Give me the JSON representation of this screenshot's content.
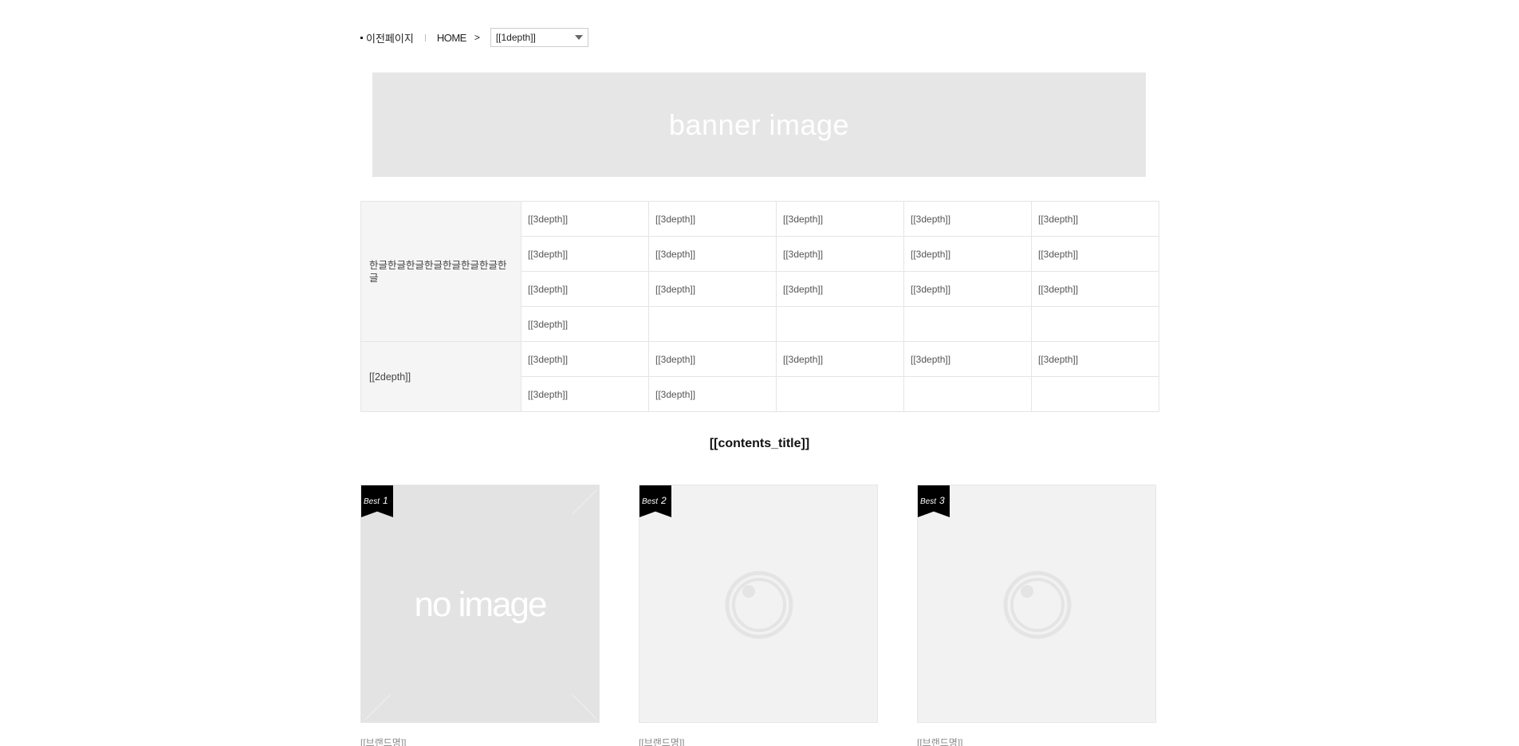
{
  "breadcrumb": {
    "prev_label": "이전페이지",
    "home_label": "HOME",
    "arrow": ">",
    "select_value": "[[1depth]]"
  },
  "banner": {
    "text": "banner image"
  },
  "category_table": {
    "groups": [
      {
        "title": "한글한글한글한글한글한글한글한글",
        "rows": [
          [
            "[[3depth]]",
            "[[3depth]]",
            "[[3depth]]",
            "[[3depth]]",
            "[[3depth]]"
          ],
          [
            "[[3depth]]",
            "[[3depth]]",
            "[[3depth]]",
            "[[3depth]]",
            "[[3depth]]"
          ],
          [
            "[[3depth]]",
            "[[3depth]]",
            "[[3depth]]",
            "[[3depth]]",
            "[[3depth]]"
          ],
          [
            "[[3depth]]",
            "",
            "",
            "",
            ""
          ]
        ]
      },
      {
        "title": "[[2depth]]",
        "rows": [
          [
            "[[3depth]]",
            "[[3depth]]",
            "[[3depth]]",
            "[[3depth]]",
            "[[3depth]]"
          ],
          [
            "[[3depth]]",
            "[[3depth]]",
            "",
            "",
            ""
          ]
        ]
      }
    ]
  },
  "contents_title": "[[contents_title]]",
  "products": [
    {
      "badge": "Best",
      "rank": "1",
      "image": "no image",
      "brand": "[[브랜드명]]"
    },
    {
      "badge": "Best",
      "rank": "2",
      "image": "camera-placeholder",
      "brand": "[[브랜드명]]"
    },
    {
      "badge": "Best",
      "rank": "3",
      "image": "camera-placeholder",
      "brand": "[[브랜드명]]"
    }
  ]
}
